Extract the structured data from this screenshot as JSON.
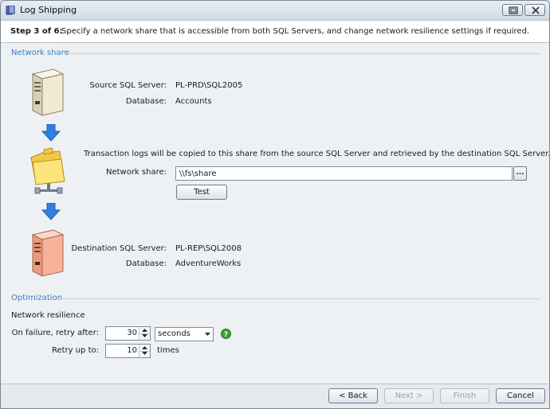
{
  "window": {
    "title": "Log Shipping"
  },
  "header": {
    "step_label": "Step 3 of 6:",
    "step_text": "Specify a network share that is accessible from both SQL Servers, and change network resilience settings if required."
  },
  "network_share_section": {
    "title": "Network share",
    "source": {
      "server_label": "Source SQL Server:",
      "server_value": "PL-PRD\\SQL2005",
      "database_label": "Database:",
      "database_value": "Accounts",
      "icon": "server-icon"
    },
    "share": {
      "description": "Transaction logs will be copied to this share from the source SQL Server and retrieved by the destination SQL Server.",
      "label": "Network share:",
      "value": "\\\\fs\\share",
      "browse_label": "...",
      "test_label": "Test",
      "icon": "shared-folder-icon"
    },
    "destination": {
      "server_label": "Destination SQL Server:",
      "server_value": "PL-REP\\SQL2008",
      "database_label": "Database:",
      "database_value": "AdventureWorks",
      "icon": "server-icon"
    },
    "arrow_color": "#2f7fe0"
  },
  "optimization_section": {
    "title": "Optimization",
    "subtitle": "Network resilience",
    "retry_after_label": "On failure, retry after:",
    "retry_after_value": "30",
    "retry_after_unit": "seconds",
    "retry_up_to_label": "Retry up to:",
    "retry_up_to_value": "10",
    "retry_up_to_unit": "times",
    "help_icon": "help-icon"
  },
  "footer": {
    "back_label": "< Back",
    "next_label": "Next >",
    "finish_label": "Finish",
    "cancel_label": "Cancel"
  },
  "colors": {
    "section_title": "#3a7cc2",
    "help_green": "#3aa12e",
    "source_server": "#f2ead2",
    "destination_server": "#f6b39a"
  }
}
